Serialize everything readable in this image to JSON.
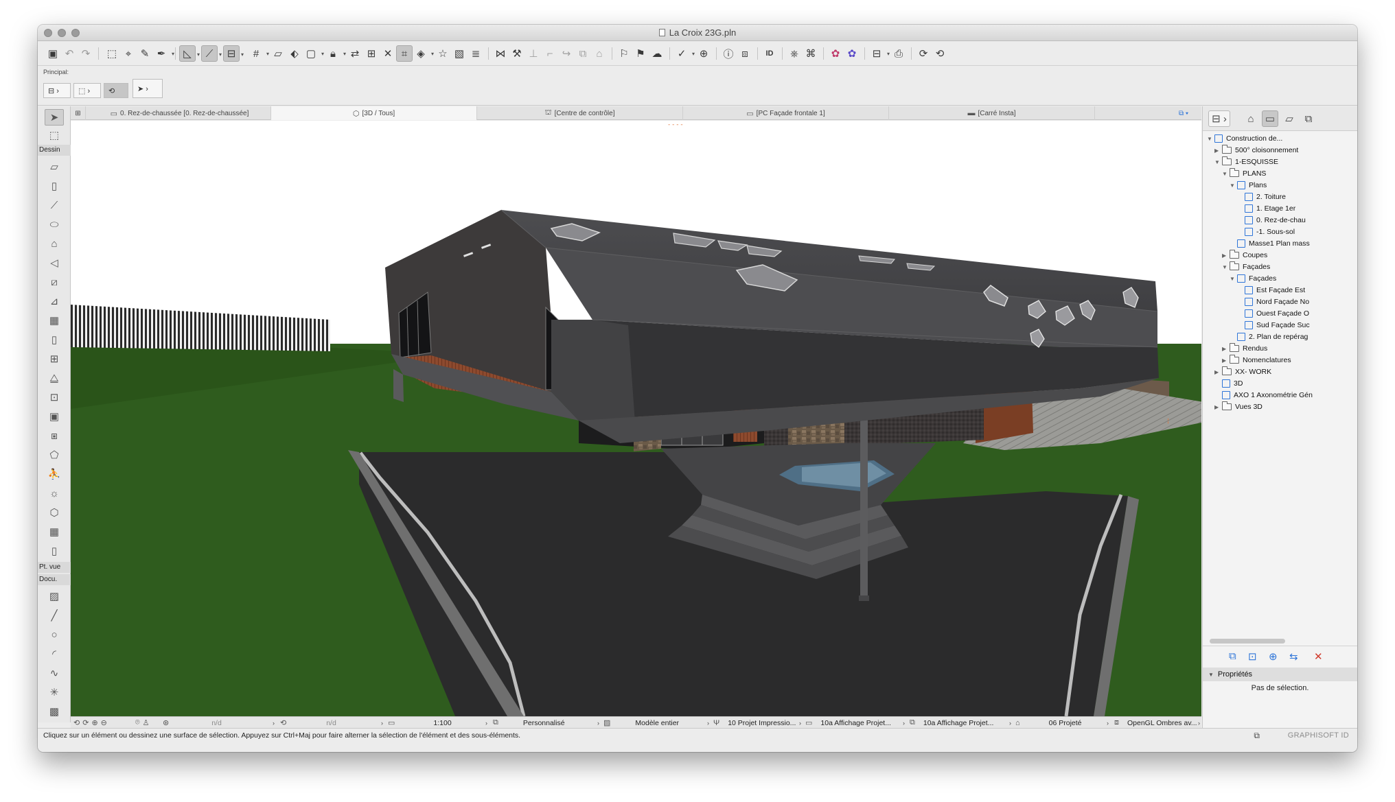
{
  "window": {
    "title": "La Croix 23G.pln"
  },
  "toolbar": {
    "icons": [
      "save-icon",
      "undo-icon",
      "redo-icon",
      "select-icon",
      "marquee-icon",
      "pick-icon",
      "inject-icon",
      "guide-icon",
      "snap-icon",
      "gravity-icon",
      "grid-icon",
      "ruler-icon",
      "hand-icon",
      "group-icon",
      "lock-icon",
      "layers-icon",
      "renovation-icon",
      "suspend-icon",
      "trace-icon",
      "wire-icon",
      "star-icon",
      "image-icon",
      "stack-icon",
      "split-icon",
      "adjust-icon",
      "intersect-icon",
      "fillet-icon",
      "offset-icon",
      "roof-icon",
      "flag-icon",
      "pdf-icon",
      "cloud-icon",
      "check-icon",
      "mesh-icon",
      "info-icon",
      "model-icon",
      "id-icon",
      "publish-icon",
      "tag-icon",
      "teamwork-icon",
      "reserve-icon",
      "layout-icon",
      "print-icon",
      "change-icon",
      "revision-icon"
    ]
  },
  "infobox": {
    "label": "Principal:"
  },
  "toolbox": {
    "group_dessin": "Dessin",
    "group_ptvue": "Pt. vue",
    "group_docu": "Docu."
  },
  "tabs": [
    {
      "label": "0. Rez-de-chaussée [0. Rez-de-chaussée]",
      "icon": "plan-icon"
    },
    {
      "label": "[3D / Tous]",
      "icon": "cube-icon"
    },
    {
      "label": "[Centre de contrôle]",
      "icon": "control-icon"
    },
    {
      "label": "[PC Façade frontale 1]",
      "icon": "elevation-icon"
    },
    {
      "label": "[Carré Insta]",
      "icon": "layout-icon"
    }
  ],
  "viewport_status": {
    "zoom_value": "n/d",
    "angle_value": "n/d",
    "scale": "1:100",
    "layer_combo": "Personnalisé",
    "model_view": "Modèle entier",
    "pen_set": "10 Projet Impressio...",
    "mvo": "10a Affichage Projet...",
    "graphic_override": "10a Affichage Projet...",
    "renovation": "06 Projeté",
    "engine": "OpenGL Ombres av..."
  },
  "status": {
    "message": "Cliquez sur un élément ou dessinez une surface de sélection. Appuyez sur Ctrl+Maj pour faire alterner la sélection de l'élément et des sous-éléments.",
    "brand": "GRAPHISOFT ID"
  },
  "navigator": {
    "tree": [
      {
        "label": "Construction de...",
        "level": 0,
        "expanded": true,
        "icon": "project"
      },
      {
        "label": "500° cloisonnement",
        "level": 1,
        "expanded": false,
        "icon": "folder"
      },
      {
        "label": "1-ESQUISSE",
        "level": 1,
        "expanded": true,
        "icon": "folder"
      },
      {
        "label": "PLANS",
        "level": 2,
        "expanded": true,
        "icon": "folder"
      },
      {
        "label": "Plans",
        "level": 3,
        "expanded": true,
        "icon": "view"
      },
      {
        "label": "2. Toiture",
        "level": 4,
        "expanded": null,
        "icon": "view"
      },
      {
        "label": "1. Etage 1er",
        "level": 4,
        "expanded": null,
        "icon": "view"
      },
      {
        "label": "0. Rez-de-chau",
        "level": 4,
        "expanded": null,
        "icon": "view"
      },
      {
        "label": "-1. Sous-sol",
        "level": 4,
        "expanded": null,
        "icon": "view"
      },
      {
        "label": "Masse1 Plan mass",
        "level": 3,
        "expanded": null,
        "icon": "view"
      },
      {
        "label": "Coupes",
        "level": 2,
        "expanded": false,
        "icon": "folder"
      },
      {
        "label": "Façades",
        "level": 2,
        "expanded": true,
        "icon": "folder"
      },
      {
        "label": "Façades",
        "level": 3,
        "expanded": true,
        "icon": "view"
      },
      {
        "label": "Est Façade Est",
        "level": 4,
        "expanded": null,
        "icon": "view"
      },
      {
        "label": "Nord Façade No",
        "level": 4,
        "expanded": null,
        "icon": "view"
      },
      {
        "label": "Ouest Façade O",
        "level": 4,
        "expanded": null,
        "icon": "view"
      },
      {
        "label": "Sud Façade Suc",
        "level": 4,
        "expanded": null,
        "icon": "view"
      },
      {
        "label": "2. Plan de repérag",
        "level": 3,
        "expanded": null,
        "icon": "view"
      },
      {
        "label": "Rendus",
        "level": 2,
        "expanded": false,
        "icon": "folder"
      },
      {
        "label": "Nomenclatures",
        "level": 2,
        "expanded": false,
        "icon": "folder"
      },
      {
        "label": "XX- WORK",
        "level": 1,
        "expanded": false,
        "icon": "folder"
      },
      {
        "label": "3D",
        "level": 1,
        "expanded": null,
        "icon": "view"
      },
      {
        "label": "AXO 1 Axonométrie Gén",
        "level": 1,
        "expanded": null,
        "icon": "view"
      },
      {
        "label": "Vues 3D",
        "level": 1,
        "expanded": false,
        "icon": "folder"
      }
    ],
    "properties_title": "Propriétés",
    "properties_text": "Pas de sélection."
  },
  "colors": {
    "sky": "#ffffff",
    "grass": "#2f5c1e",
    "asphalt": "#2b2b2c",
    "roof": "#4a4a4c",
    "accent": "#2d74d8"
  }
}
